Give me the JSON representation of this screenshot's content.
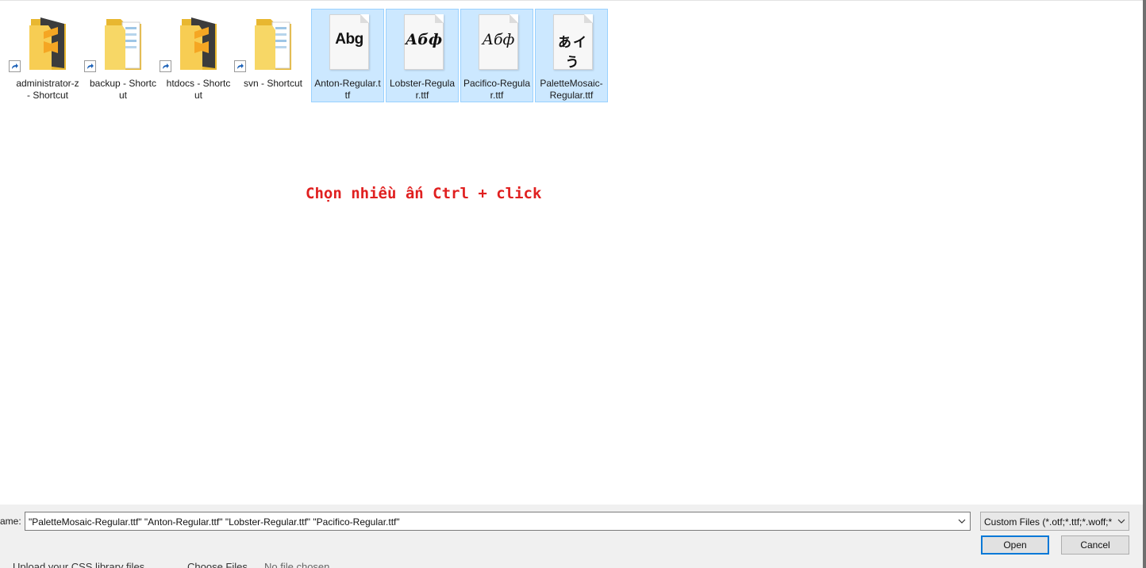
{
  "files": {
    "items": [
      {
        "label": "administrator-z - Shortcut",
        "type": "folder-sublime-shortcut",
        "selected": false
      },
      {
        "label": "backup - Shortcut",
        "type": "folder-documents-shortcut",
        "selected": false
      },
      {
        "label": "htdocs - Shortcut",
        "type": "folder-sublime-shortcut",
        "selected": false
      },
      {
        "label": "svn - Shortcut",
        "type": "folder-documents-shortcut",
        "selected": false
      },
      {
        "label": "Anton-Regular.ttf",
        "type": "font-file",
        "sample": "Abg",
        "selected": true
      },
      {
        "label": "Lobster-Regular.ttf",
        "type": "font-file",
        "sample": "Абф",
        "selected": true
      },
      {
        "label": "Pacifico-Regular.ttf",
        "type": "font-file",
        "sample": "Абф",
        "selected": true
      },
      {
        "label": "PaletteMosaic-Regular.ttf",
        "type": "font-file",
        "sample": "あイう",
        "selected": true
      }
    ]
  },
  "annotation": {
    "text": "Chọn nhiều ấn Ctrl + click",
    "color": "#e02020"
  },
  "footer": {
    "filename_label": "ame:",
    "filename_value": "\"PaletteMosaic-Regular.ttf\" \"Anton-Regular.ttf\" \"Lobster-Regular.ttf\" \"Pacifico-Regular.ttf\"",
    "filetype_value": "Custom Files (*.otf;*.ttf;*.woff;*",
    "open_label": "Open",
    "cancel_label": "Cancel"
  },
  "underlying_page": {
    "upload_text": "Upload your CSS library files",
    "choose_files_label": "Choose Files",
    "no_file_text": "No file chosen"
  },
  "colors": {
    "selection_bg": "#cce8ff",
    "selection_border": "#99d1ff",
    "primary_button_border": "#0078d7"
  }
}
